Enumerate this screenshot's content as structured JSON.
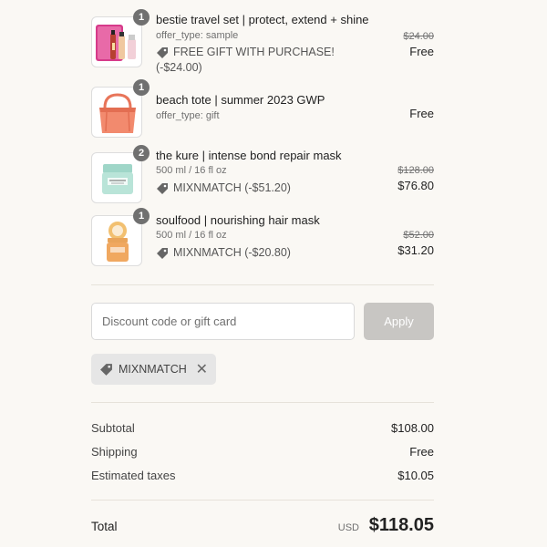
{
  "items": [
    {
      "qty": "1",
      "name": "bestie travel set | protect, extend + shine",
      "sub": "offer_type: sample",
      "discount": "FREE GIFT WITH PURCHASE!",
      "discount_amount": "(-$24.00)",
      "original_price": "$24.00",
      "price": "Free"
    },
    {
      "qty": "1",
      "name": "beach tote | summer 2023 GWP",
      "sub": "offer_type: gift",
      "price": "Free"
    },
    {
      "qty": "2",
      "name": "the kure | intense bond repair mask",
      "sub": "500 ml / 16 fl oz",
      "discount": "MIXNMATCH (-$51.20)",
      "original_price": "$128.00",
      "price": "$76.80"
    },
    {
      "qty": "1",
      "name": "soulfood | nourishing hair mask",
      "sub": "500 ml / 16 fl oz",
      "discount": "MIXNMATCH (-$20.80)",
      "original_price": "$52.00",
      "price": "$31.20"
    }
  ],
  "discount_field": {
    "placeholder": "Discount code or gift card"
  },
  "apply_label": "Apply",
  "applied_code": "MIXNMATCH",
  "summary": {
    "subtotal_label": "Subtotal",
    "subtotal": "$108.00",
    "shipping_label": "Shipping",
    "shipping": "Free",
    "taxes_label": "Estimated taxes",
    "taxes": "$10.05"
  },
  "total": {
    "label": "Total",
    "currency": "USD",
    "value": "$118.05"
  },
  "colors": {
    "background": "#faf8f4",
    "apply_disabled": "#c8c6c3",
    "badge": "#707070"
  }
}
